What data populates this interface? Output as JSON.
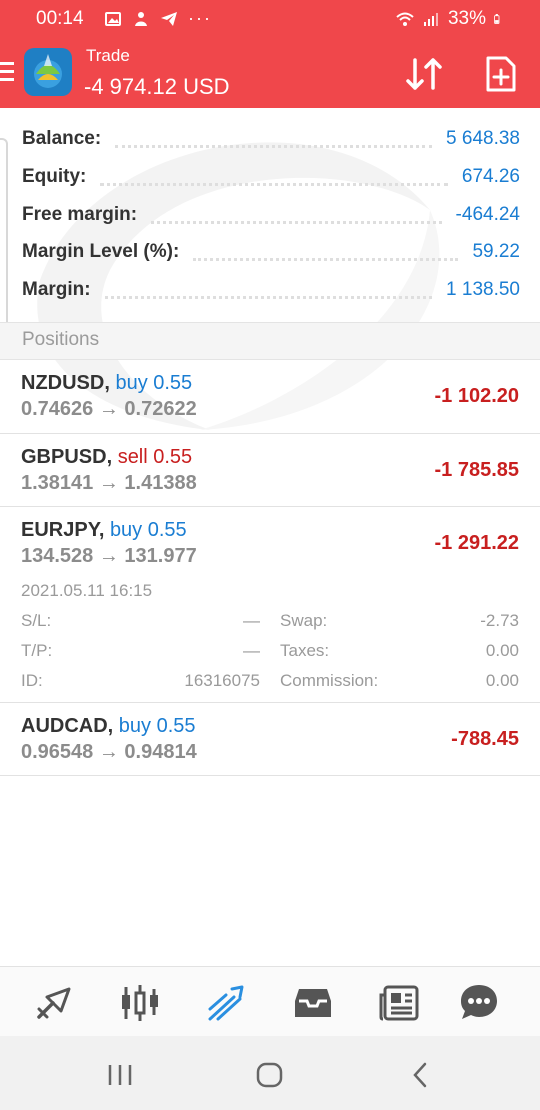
{
  "status_bar": {
    "time": "00:14",
    "battery": "33%",
    "more": "···"
  },
  "app_bar": {
    "title": "Trade",
    "profit": "-4 974.12 USD",
    "icons": [
      "menu-icon",
      "app-logo",
      "sort-icon",
      "new-order-icon"
    ]
  },
  "summary": {
    "rows": [
      {
        "label": "Balance:",
        "value": "5 648.38"
      },
      {
        "label": "Equity:",
        "value": "674.26"
      },
      {
        "label": "Free margin:",
        "value": "-464.24"
      },
      {
        "label": "Margin Level (%):",
        "value": "59.22"
      },
      {
        "label": "Margin:",
        "value": "1 138.50"
      }
    ]
  },
  "positions_header": "Positions",
  "positions": [
    {
      "symbol": "NZDUSD,",
      "direction": "buy 0.55",
      "type": "buy",
      "open_price": "0.74626",
      "arrow": "→",
      "current_price": "0.72622",
      "profit": "-1 102.20"
    },
    {
      "symbol": "GBPUSD,",
      "direction": "sell 0.55",
      "type": "sell",
      "open_price": "1.38141",
      "arrow": "→",
      "current_price": "1.41388",
      "profit": "-1 785.85"
    },
    {
      "symbol": "EURJPY,",
      "direction": "buy 0.55",
      "type": "buy",
      "open_price": "134.528",
      "arrow": "→",
      "current_price": "131.977",
      "profit": "-1 291.22",
      "details": {
        "date": "2021.05.11 16:15",
        "sl_label": "S/L:",
        "sl_value": "—",
        "swap_label": "Swap:",
        "swap_value": "-2.73",
        "tp_label": "T/P:",
        "tp_value": "—",
        "taxes_label": "Taxes:",
        "taxes_value": "0.00",
        "id_label": "ID:",
        "id_value": "16316075",
        "commission_label": "Commission:",
        "commission_value": "0.00"
      }
    },
    {
      "symbol": "AUDCAD,",
      "direction": "buy 0.55",
      "type": "buy",
      "open_price": "0.96548",
      "arrow": "→",
      "current_price": "0.94814",
      "profit": "-788.45"
    }
  ],
  "bottom_nav": {
    "items": [
      "quotes-icon",
      "chart-icon",
      "trade-icon",
      "history-icon",
      "news-icon",
      "chat-icon"
    ],
    "active": "trade-icon",
    "active_color": "#2a8fe0",
    "inactive_color": "#555555"
  },
  "system_nav": [
    "recent-apps-icon",
    "home-icon",
    "back-icon"
  ],
  "colors": {
    "header": "#f0474b",
    "positive_blue": "#1a7dd2",
    "loss_red": "#c81f1f"
  }
}
